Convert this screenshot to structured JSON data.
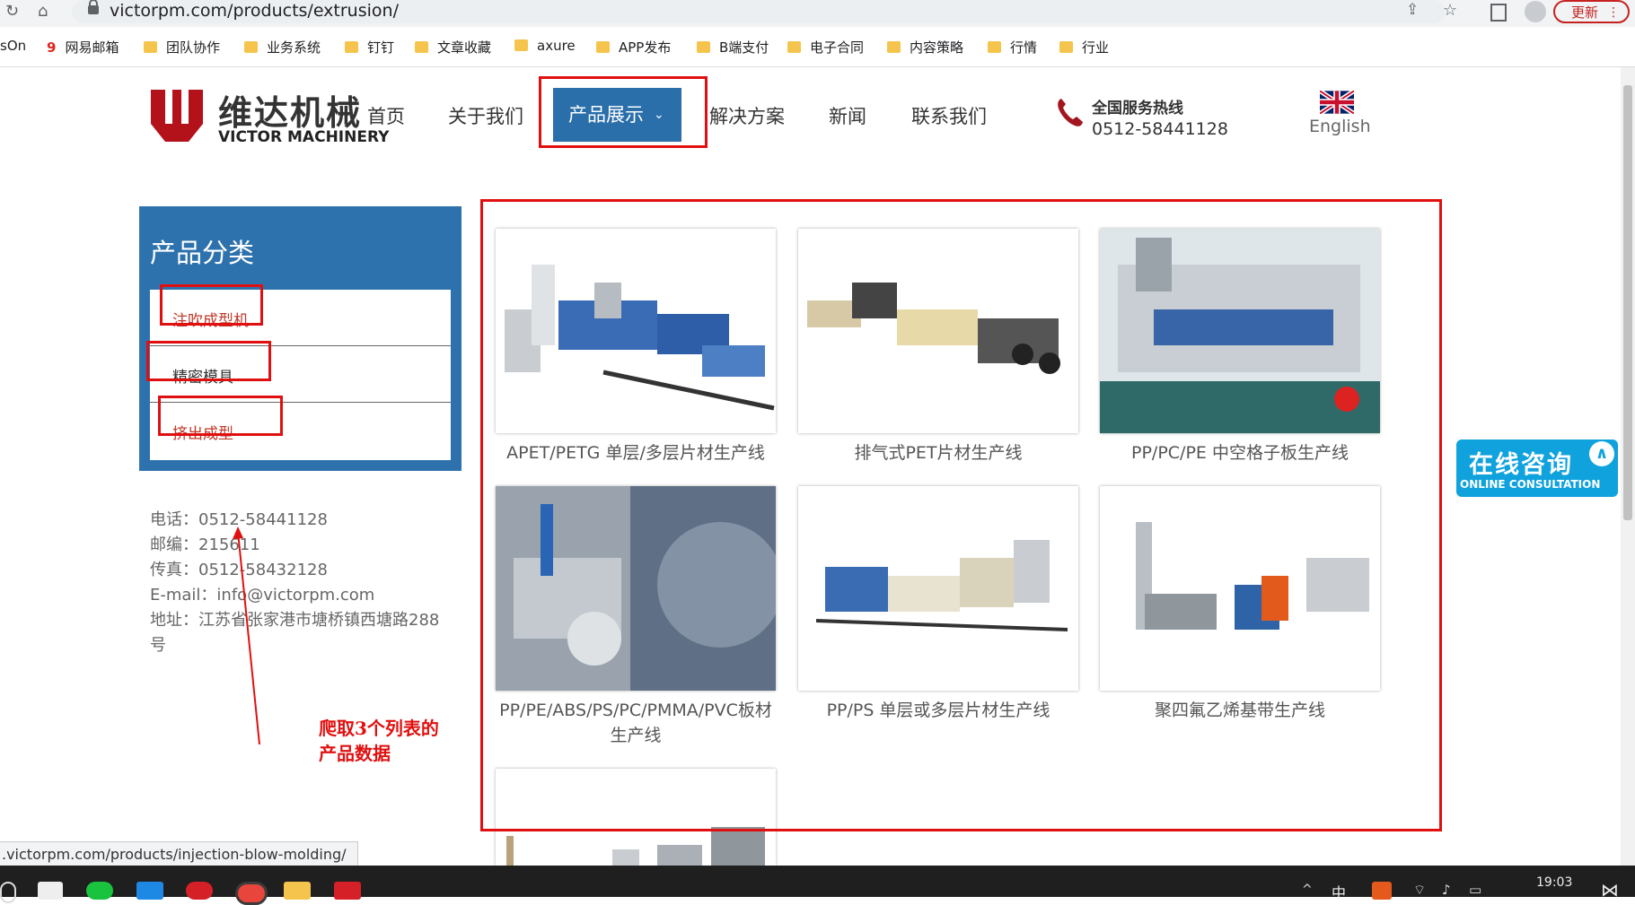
{
  "browser": {
    "url": "victorpm.com/products/extrusion/",
    "update_label": "更新",
    "status_url": ".victorpm.com/products/injection-blow-molding/"
  },
  "bookmarks": [
    "sOn",
    "网易邮箱",
    "团队协作",
    "业务系统",
    "钉钉",
    "文章收藏",
    "axure",
    "APP发布",
    "B端支付",
    "电子合同",
    "内容策略",
    "行情",
    "行业"
  ],
  "header": {
    "logo_cn": "维达机械",
    "logo_en": "VICTOR MACHINERY",
    "menu": [
      "首页",
      "关于我们",
      "产品展示",
      "解决方案",
      "新闻",
      "联系我们"
    ],
    "hotline_title": "全国服务热线",
    "hotline_number": "0512-58441128",
    "language": "English"
  },
  "sidebar": {
    "title": "产品分类",
    "items": [
      "注吹成型机",
      "精密模具",
      "挤出成型"
    ],
    "contact": {
      "tel": "电话：0512-58441128",
      "postcode": "邮编：215611",
      "fax": "传真：0512-58432128",
      "email": "E-mail：info@victorpm.com",
      "address_1": "地址：江苏省张家港市塘桥镇西塘路288",
      "address_2": "号"
    }
  },
  "products": [
    {
      "name": "APET/PETG 单层/多层片材生产线"
    },
    {
      "name": "排气式PET片材生产线"
    },
    {
      "name": "PP/PC/PE 中空格子板生产线"
    },
    {
      "name_1": "PP/PE/ABS/PS/PC/PMMA/PVC板材",
      "name_2": "生产线"
    },
    {
      "name": "PP/PS 单层或多层片材生产线"
    },
    {
      "name": "聚四氟乙烯基带生产线"
    }
  ],
  "annotation": {
    "line1": "爬取3个列表的",
    "line2": "产品数据"
  },
  "consult": {
    "cn": "在线咨询",
    "en": "ONLINE CONSULTATION"
  },
  "taskbar": {
    "ime": "中",
    "time": "19:03"
  }
}
